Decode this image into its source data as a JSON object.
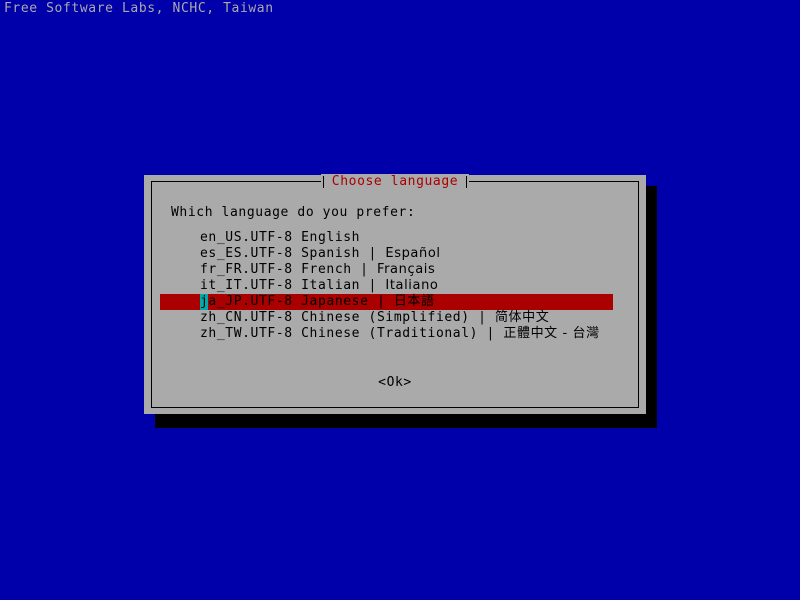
{
  "console": {
    "header": "Free Software Labs, NCHC, Taiwan"
  },
  "colors": {
    "background_blue": "#0000aa",
    "panel_gray": "#aaaaaa",
    "title_red": "#aa0000",
    "highlight_red": "#aa0000",
    "cursor_cyan": "#00aaaa",
    "text_black": "#000000",
    "header_text_gray": "#aaaaaa",
    "shadow_black": "#000000"
  },
  "dialog": {
    "title": "Choose language",
    "prompt": "Which language do you prefer:",
    "ok_label": "<Ok>",
    "selected_index": 4,
    "languages": [
      {
        "locale": "en_US.UTF-8",
        "name": "English",
        "native": ""
      },
      {
        "locale": "es_ES.UTF-8",
        "name": "Spanish",
        "native": "Español"
      },
      {
        "locale": "fr_FR.UTF-8",
        "name": "French",
        "native": "Français"
      },
      {
        "locale": "it_IT.UTF-8",
        "name": "Italian",
        "native": "Italiano"
      },
      {
        "locale": "ja_JP.UTF-8",
        "name": "Japanese",
        "native": "日本語"
      },
      {
        "locale": "zh_CN.UTF-8",
        "name": "Chinese (Simplified)",
        "native": "简体中文"
      },
      {
        "locale": "zh_TW.UTF-8",
        "name": "Chinese (Traditional)",
        "native": "正體中文 - 台灣"
      }
    ]
  }
}
